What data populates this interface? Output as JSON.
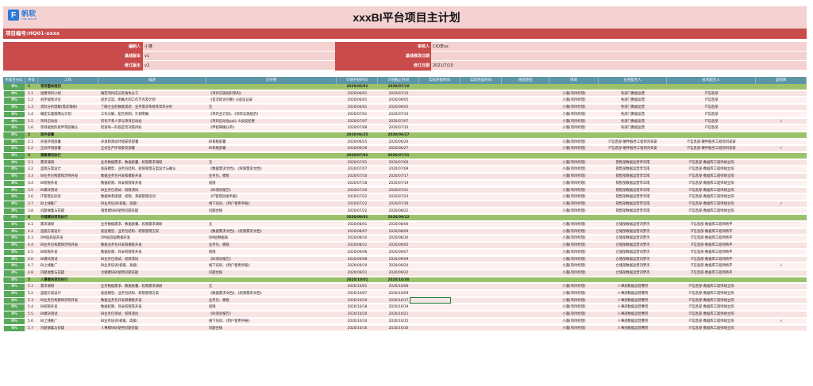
{
  "logo": {
    "mark": "F",
    "name": "帆软",
    "sub": "FINE REPORT"
  },
  "title": "xxxBI平台项目主计划",
  "project_no": "项目编号:HQ01-xxxx",
  "info": {
    "editor_label": "编制人",
    "editor": "小蓬",
    "baseline_ver_label": "基线版本",
    "baseline_ver": "v1",
    "rev_ver_label": "修订版本",
    "rev_ver": "v2",
    "approver_label": "审核人",
    "approver": "CIO李xx",
    "baseline_date_label": "基线修改日期",
    "baseline_date": "",
    "rev_date_label": "修订日期",
    "rev_date": "2021/7/10"
  },
  "columns": [
    "完成百分比",
    "序号",
    "工作",
    "描述",
    "交付物",
    "计划开始时间",
    "计划截止时间",
    "实际开始时间",
    "实际完成时间",
    "滞后原因",
    "项目",
    "业务配合人",
    "技术配合人",
    "里程碑"
  ],
  "rows": [
    {
      "phase": true,
      "pct": "0%",
      "no": "1",
      "work": "项目整体规划",
      "desc": "",
      "deliv": "",
      "ps": "2020/06/01",
      "pe": "2020/07/10",
      "proj": "",
      "biz": "",
      "tech": "",
      "ms": ""
    },
    {
      "pct": "0%",
      "no": "1.1",
      "work": "组建项目小组",
      "desc": "确定项目成员及角色分工",
      "deliv": "《项目实施组织架构》",
      "ps": "2020/06/01",
      "pe": "2020/07/10",
      "proj": "小蓬(项目经理)",
      "biz": "各部门数据运营",
      "tech": "IT信息部",
      "ms": ""
    },
    {
      "pct": "0%",
      "no": "1.2",
      "work": "初步规划讨论",
      "desc": "初步交流、明确大的工作节点及计划",
      "deliv": "《首次碎访问要》&会议记录",
      "ps": "2020/06/01",
      "pe": "2020/06/05",
      "proj": "小蓬(项目经理)",
      "biz": "各部门数据运营",
      "tech": "IT信息部",
      "ms": ""
    },
    {
      "pct": "0%",
      "no": "1.3",
      "work": "资料分析理解(需求调研)",
      "desc": "了解企业的数据现状、业务需求系统等资料分析",
      "deliv": "无",
      "ps": "2020/06/01",
      "pe": "2020/06/05",
      "proj": "小蓬(项目经理)",
      "biz": "各部门数据运营",
      "tech": "IT信息部",
      "ms": ""
    },
    {
      "pct": "0%",
      "no": "1.4",
      "work": "确定实施策略与计划",
      "desc": "工作分解、配合机制、计划明确",
      "deliv": "《项目主计划》、《项目实施规范》",
      "ps": "2020/07/01",
      "pe": "2020/07/10",
      "proj": "小蓬(项目经理)",
      "biz": "各部门数据运营",
      "tech": "IT信息部",
      "ms": ""
    },
    {
      "pct": "0%",
      "no": "1.5",
      "work": "项目启动会",
      "desc": "所有干系人参与项目启动会",
      "deliv": "《项目启动会ppt》&会议纪要",
      "ps": "2020/07/07",
      "pe": "2020/07/07",
      "proj": "小蓬(项目经理)",
      "biz": "各部门数据运营",
      "tech": "IT信息部",
      "ms": "√"
    },
    {
      "pct": "0%",
      "no": "1.6",
      "work": "项目规划阶段甲等验确认",
      "desc": "检查每一阶段是否决策目标",
      "deliv": "《甲程碑确认单》",
      "ps": "2020/07/08",
      "pe": "2020/07/10",
      "proj": "小蓬(项目经理)",
      "biz": "各部门数据运营",
      "tech": "IT信息部",
      "ms": ""
    },
    {
      "phase": true,
      "pct": "0%",
      "no": "2",
      "work": "软件部署",
      "desc": "",
      "deliv": "",
      "ps": "2020/06/25",
      "pe": "2020/06/27",
      "proj": "",
      "biz": "",
      "tech": "",
      "ms": ""
    },
    {
      "pct": "0%",
      "no": "2.1",
      "work": "开发环境部署",
      "desc": "开发和测试环境安装部署",
      "deliv": "BI系统部署",
      "ps": "2020/06/25",
      "pe": "2020/06/26",
      "proj": "小蓬(项目经理)",
      "biz": "IT信息部-硬件服务工程师刘采安",
      "tech": "IT信息部-硬件服务工程师刘采安",
      "ms": ""
    },
    {
      "pct": "0%",
      "no": "2.2",
      "work": "正式环境部署",
      "desc": "正式生产环境安装部署",
      "deliv": "BI系统部署",
      "ps": "2020/06/26",
      "pe": "2020/06/27",
      "proj": "小蓬(项目经理)",
      "biz": "IT信息部-硬件服务工程师刘采安",
      "tech": "IT信息部-硬件服务工程师刘采安",
      "ms": "√"
    },
    {
      "phase": true,
      "pct": "0%",
      "no": "3",
      "work": "销售模块执行",
      "desc": "",
      "deliv": "",
      "ps": "2020/07/01",
      "pe": "2020/07/31",
      "proj": "",
      "biz": "",
      "tech": "",
      "ms": ""
    },
    {
      "pct": "0%",
      "no": "3.1",
      "work": "需求调研",
      "desc": "业务数据需求、数据质量、权限需求调研",
      "deliv": "无",
      "ps": "2020/07/01",
      "pe": "2020/07/06",
      "proj": "小蓬(项目经理)",
      "biz": "销售部数据运营李华南",
      "tech": "IT信息部-数据库工程师胡立阳",
      "ms": ""
    },
    {
      "pct": "0%",
      "no": "3.2",
      "work": "蓝图方案设计",
      "desc": "底层模型、业务包结构、权限管理方案设计与确认",
      "deliv": "《数据需求文档》、《权限需求文档》",
      "ps": "2020/07/07",
      "pe": "2020/07/09",
      "proj": "小蓬(项目经理)",
      "biz": "销售部数据运营李华南",
      "tech": "IT信息部-数据库工程师胡立阳",
      "ms": ""
    },
    {
      "pct": "0%",
      "no": "3.3",
      "work": "BI业务包构建和示例开发",
      "desc": "数据业务包开发和模板开发",
      "deliv": "业务包、模板",
      "ps": "2020/07/10",
      "pe": "2020/07/17",
      "proj": "小蓬(项目经理)",
      "biz": "销售部数据运营李华南",
      "tech": "IT信息部-数据库工程师胡立阳",
      "ms": ""
    },
    {
      "pct": "0%",
      "no": "3.4",
      "work": "BI权限开发",
      "desc": "数据权限、目录权限等开发",
      "deliv": "权限",
      "ps": "2020/07/18",
      "pe": "2020/07/19",
      "proj": "小蓬(项目经理)",
      "biz": "销售部数据运营李华南",
      "tech": "IT信息部-数据库工程师胡立阳",
      "ms": ""
    },
    {
      "pct": "0%",
      "no": "3.5",
      "work": "BI模块测试",
      "desc": "BI业务包测试、权限测试",
      "deliv": "《BI测试报告》",
      "ps": "2020/07/20",
      "pe": "2020/07/21",
      "proj": "小蓬(项目经理)",
      "biz": "销售部数据运营李华南",
      "tech": "IT信息部-数据库工程师胡立阳",
      "ms": ""
    },
    {
      "pct": "0%",
      "no": "3.6",
      "work": "IT管理员培训",
      "desc": "数据体系搭建、权限、系统管理培训",
      "deliv": "《IT管理运维手册》",
      "ps": "2020/07/22",
      "pe": "2020/07/24",
      "proj": "小蓬(项目经理)",
      "biz": "销售部数据运营李华南",
      "tech": "IT信息部-数据库工程师胡立阳",
      "ms": ""
    },
    {
      "pct": "0%",
      "no": "3.7",
      "work": "BI上线推广",
      "desc": "BI业务培训(初级、高级)",
      "deliv": "线下培训、《用户使用手册》",
      "ps": "2020/07/22",
      "pe": "2020/07/30",
      "proj": "小蓬(项目经理)",
      "biz": "销售部数据运营李华南",
      "tech": "IT信息部-数据库工程师胡立阳",
      "ms": "√"
    },
    {
      "pct": "0%",
      "no": "3.8",
      "work": "问题收集与答疑",
      "desc": "销售模块BI使用问题答疑",
      "deliv": "问题台账",
      "ps": "2020/07/22",
      "pe": "2020/08/22",
      "proj": "小蓬(项目经理)",
      "biz": "销售部数据运营李华南",
      "tech": "IT信息部-数据库工程师胡立阳",
      "ms": ""
    },
    {
      "phase": true,
      "pct": "0%",
      "no": "4",
      "work": "仓储模块项目执行",
      "desc": "",
      "deliv": "",
      "ps": "2020/08/01",
      "pe": "2020/09/22",
      "proj": "",
      "biz": "",
      "tech": "",
      "ms": ""
    },
    {
      "pct": "0%",
      "no": "4.1",
      "work": "需求调研",
      "desc": "业务数据需求、数据质量、权限需求调研",
      "deliv": "无",
      "ps": "2020/08/01",
      "pe": "2020/08/06",
      "proj": "小蓬(项目经理)",
      "biz": "仓储部数据运营刘梦杰",
      "tech": "IT信息部-数据库工程师杨平",
      "ms": ""
    },
    {
      "pct": "0%",
      "no": "4.2",
      "work": "蓝图方案设计",
      "desc": "底层模型、业务包结构、权限管理方案",
      "deliv": "《数据需求文档》、《权限需求文档》",
      "ps": "2020/08/07",
      "pe": "2020/08/09",
      "proj": "小蓬(项目经理)",
      "biz": "仓储部数据运营刘梦杰",
      "tech": "IT信息部-数据库工程师杨平",
      "ms": ""
    },
    {
      "pct": "0%",
      "no": "4.3",
      "work": "DM层底层开发",
      "desc": "DM层底层数据开发",
      "deliv": "DM层数据表",
      "ps": "2020/08/10",
      "pe": "2020/08/30",
      "proj": "小蓬(项目经理)",
      "biz": "仓储部数据运营刘梦杰",
      "tech": "IT信息部-数据库工程师杨平",
      "ms": ""
    },
    {
      "pct": "0%",
      "no": "4.4",
      "work": "BI业务包构建和示例开发",
      "desc": "数据业务包开发和模板开发",
      "deliv": "业务包、模板",
      "ps": "2020/08/31",
      "pe": "2020/09/05",
      "proj": "小蓬(项目经理)",
      "biz": "仓储部数据运营刘梦杰",
      "tech": "IT信息部-数据库工程师杨平",
      "ms": ""
    },
    {
      "pct": "0%",
      "no": "4.5",
      "work": "BI权限开发",
      "desc": "数据权限、目录权限等开发",
      "deliv": "权限",
      "ps": "2020/09/06",
      "pe": "2020/09/07",
      "proj": "小蓬(项目经理)",
      "biz": "仓储部数据运营刘梦杰",
      "tech": "IT信息部-数据库工程师杨平",
      "ms": ""
    },
    {
      "pct": "0%",
      "no": "4.6",
      "work": "BI模块测试",
      "desc": "BI业务包测试、权限测试",
      "deliv": "《BI测试报告》",
      "ps": "2020/09/08",
      "pe": "2020/09/09",
      "proj": "小蓬(项目经理)",
      "biz": "仓储部数据运营刘梦杰",
      "tech": "IT信息部-数据库工程师杨平",
      "ms": ""
    },
    {
      "pct": "0%",
      "no": "4.7",
      "work": "BI上线推广",
      "desc": "BI业务培训(初级、高级)",
      "deliv": "线下培训、《用户使用手册》",
      "ps": "2020/09/10",
      "pe": "2020/09/20",
      "proj": "小蓬(项目经理)",
      "biz": "仓储部数据运营刘梦杰",
      "tech": "IT信息部-数据库工程师杨平",
      "ms": "√"
    },
    {
      "pct": "0%",
      "no": "4.8",
      "work": "问题收集与答疑",
      "desc": "仓储模块BI使用问题答疑",
      "deliv": "问题台账",
      "ps": "2020/09/21",
      "pe": "2020/09/22",
      "proj": "小蓬(项目经理)",
      "biz": "仓储部数据运营刘梦杰",
      "tech": "IT信息部-数据库工程师杨平",
      "ms": ""
    },
    {
      "phase": true,
      "pct": "0%",
      "no": "5",
      "work": "人事模块项目执行",
      "desc": "",
      "deliv": "",
      "ps": "2020/10/01",
      "pe": "2020/10/30",
      "proj": "",
      "biz": "",
      "tech": "",
      "ms": ""
    },
    {
      "pct": "0%",
      "no": "5.1",
      "work": "需求调研",
      "desc": "业务数据需求、数据质量、权限需求调研",
      "deliv": "无",
      "ps": "2020/10/01",
      "pe": "2020/10/06",
      "proj": "小蓬(项目经理)",
      "biz": "人事部数据运营曹贺",
      "tech": "IT信息部-数据库工程师胡立阳",
      "ms": ""
    },
    {
      "pct": "0%",
      "no": "5.2",
      "work": "蓝图方案设计",
      "desc": "底层模型、业务包结构、权限管理方案",
      "deliv": "《数据需求文档》、《权限需求文档》",
      "ps": "2020/10/07",
      "pe": "2020/10/09",
      "proj": "小蓬(项目经理)",
      "biz": "人事部数据运营曹贺",
      "tech": "IT信息部-数据库工程师胡立阳",
      "ms": ""
    },
    {
      "pct": "0%",
      "no": "5.3",
      "work": "BI业务包构建和示例开发",
      "desc": "数据业务包开发和模板开发",
      "deliv": "业务包、模板",
      "ps": "2020/10/10",
      "pe": "2020/10/17",
      "proj": "小蓬(项目经理)",
      "biz": "人事部数据运营曹贺",
      "tech": "IT信息部-数据库工程师胡立阳",
      "ms": ""
    },
    {
      "pct": "0%",
      "no": "5.4",
      "work": "BI权限开发",
      "desc": "数据权限、目录权限等开发",
      "deliv": "权限",
      "ps": "2020/10/18",
      "pe": "2020/10/19",
      "proj": "小蓬(项目经理)",
      "biz": "人事部数据运营曹贺",
      "tech": "IT信息部-数据库工程师胡立阳",
      "ms": ""
    },
    {
      "pct": "0%",
      "no": "5.5",
      "work": "BI模块测试",
      "desc": "BI业务包测试、权限测试",
      "deliv": "《BI测试报告》",
      "ps": "2020/10/20",
      "pe": "2020/10/21",
      "proj": "小蓬(项目经理)",
      "biz": "人事部数据运营曹贺",
      "tech": "IT信息部-数据库工程师胡立阳",
      "ms": ""
    },
    {
      "pct": "0%",
      "no": "5.6",
      "work": "BI上线推广",
      "desc": "BI业务培训(初级、高级)",
      "deliv": "线下培训、《用户使用手册》",
      "ps": "2020/10/10",
      "pe": "2020/10/15",
      "proj": "小蓬(项目经理)",
      "biz": "人事部数据运营曹贺",
      "tech": "IT信息部-数据库工程师胡立阳",
      "ms": "√"
    },
    {
      "pct": "0%",
      "no": "5.7",
      "work": "问题收集与答疑",
      "desc": "人事模块BI使用问题答疑",
      "deliv": "问题台账",
      "ps": "2020/10/16",
      "pe": "2020/10/30",
      "proj": "小蓬(项目经理)",
      "biz": "人事部数据运营曹贺",
      "tech": "IT信息部-数据库工程师胡立阳",
      "ms": ""
    }
  ]
}
